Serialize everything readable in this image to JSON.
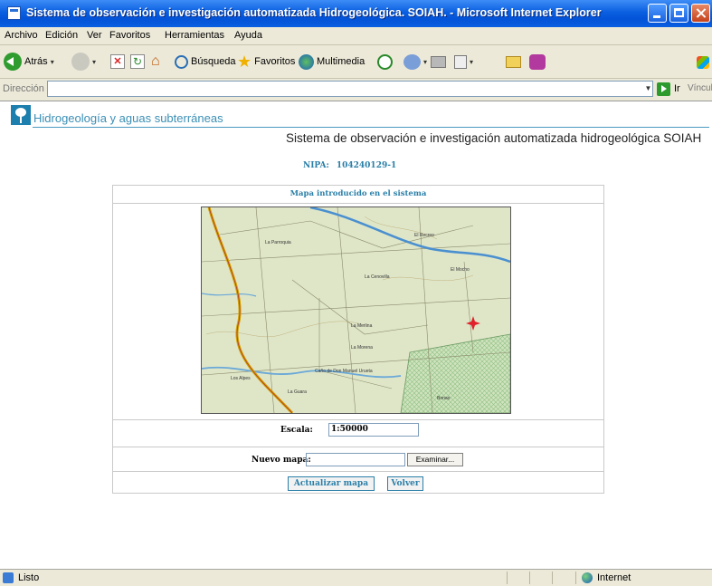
{
  "window": {
    "title": "Sistema de observación e investigación automatizada Hidrogeológica. SOIAH. - Microsoft Internet Explorer"
  },
  "menu": [
    "Archivo",
    "Edición",
    "Ver",
    "Favoritos",
    "Herramientas",
    "Ayuda"
  ],
  "toolbar": {
    "back": "Atrás",
    "search": "Búsqueda",
    "favorites": "Favoritos",
    "media": "Multimedia"
  },
  "address": {
    "label": "Dirección",
    "value": "",
    "go": "Ir",
    "links": "Vínculos"
  },
  "page": {
    "site_name": "Hidrogeología y aguas subterráneas",
    "system_title": "Sistema de observación e investigación automatizada hidrogeológica SOIAH",
    "nipa_label": "NIPA:",
    "nipa_value": "104240129-1",
    "panel_title": "Mapa introducido en el sistema",
    "map_labels": [
      "La Parroquia",
      "El Recreo",
      "La Cenovilla",
      "El Mocho",
      "La Merlina",
      "La Morena",
      "Caño de Don Manuel Urueta",
      "Los Alpes",
      "La Guara",
      "Bonao"
    ],
    "scale_label": "Escala:",
    "scale_value": "1:50000",
    "new_map_label": "Nuevo mapa:",
    "browse_button": "Examinar...",
    "update_button": "Actualizar mapa",
    "back_button": "Volver"
  },
  "status": {
    "text": "Listo",
    "zone": "Internet"
  },
  "colors": {
    "accent": "#2a7fa8",
    "title_bar": "#0a5fe0",
    "map_marker": "#e0202a"
  }
}
